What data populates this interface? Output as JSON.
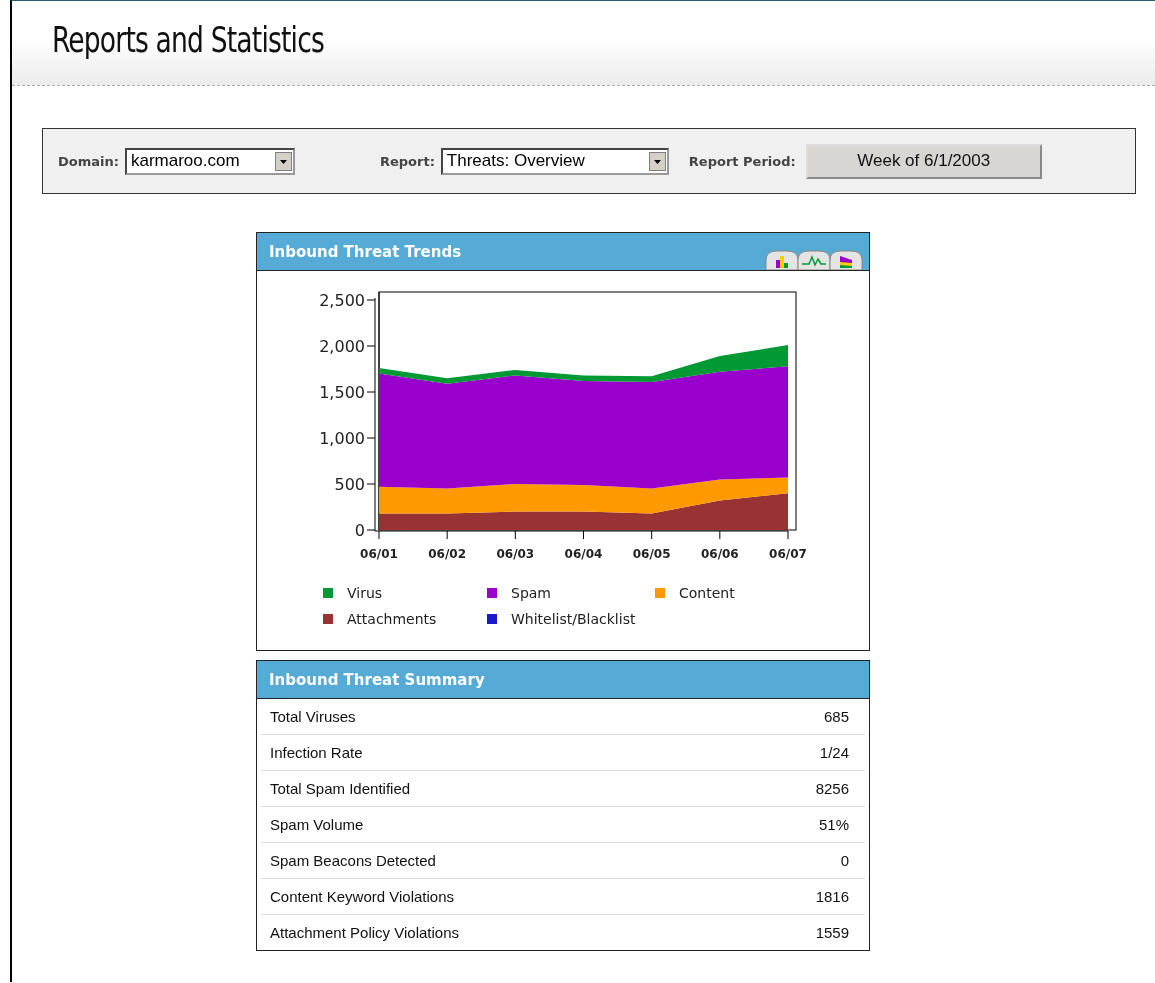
{
  "page": {
    "title": "Reports and Statistics"
  },
  "filters": {
    "domain": {
      "label": "Domain:",
      "value": "karmaroo.com"
    },
    "report": {
      "label": "Report:",
      "value": "Threats: Overview"
    },
    "period": {
      "label": "Report Period:",
      "value": "Week of 6/1/2003"
    }
  },
  "trends_panel": {
    "title": "Inbound Threat Trends",
    "chart_data": {
      "type": "area",
      "stacked": true,
      "categories": [
        "06/01",
        "06/02",
        "06/03",
        "06/04",
        "06/05",
        "06/06",
        "06/07"
      ],
      "ylim": [
        0,
        2500
      ],
      "yticks": [
        {
          "value": 0,
          "label": "0"
        },
        {
          "value": 500,
          "label": "500"
        },
        {
          "value": 1000,
          "label": "1,000"
        },
        {
          "value": 1500,
          "label": "1,500"
        },
        {
          "value": 2000,
          "label": "2,000"
        },
        {
          "value": 2500,
          "label": "2,500"
        }
      ],
      "series": [
        {
          "name": "Virus",
          "color": "#009933",
          "values": [
            60,
            60,
            60,
            60,
            60,
            170,
            230
          ]
        },
        {
          "name": "Spam",
          "color": "#9900cc",
          "values": [
            1230,
            1140,
            1180,
            1130,
            1160,
            1170,
            1210
          ]
        },
        {
          "name": "Content",
          "color": "#ff9900",
          "values": [
            290,
            270,
            300,
            290,
            270,
            230,
            170
          ]
        },
        {
          "name": "Attachments",
          "color": "#993333",
          "values": [
            180,
            180,
            200,
            200,
            180,
            320,
            400
          ]
        },
        {
          "name": "Whitelist/Blacklist",
          "color": "#1a1acc",
          "values": [
            null,
            null,
            null,
            null,
            null,
            null,
            null
          ]
        }
      ],
      "legend": true
    }
  },
  "summary_panel": {
    "title": "Inbound Threat Summary",
    "rows": [
      {
        "label": "Total Viruses",
        "value": "685"
      },
      {
        "label": "Infection Rate",
        "value": "1/24"
      },
      {
        "label": "Total Spam Identified",
        "value": "8256"
      },
      {
        "label": "Spam Volume",
        "value": "51%"
      },
      {
        "label": "Spam Beacons Detected",
        "value": "0"
      },
      {
        "label": "Content Keyword Violations",
        "value": "1816"
      },
      {
        "label": "Attachment Policy Violations",
        "value": "1559"
      }
    ]
  }
}
